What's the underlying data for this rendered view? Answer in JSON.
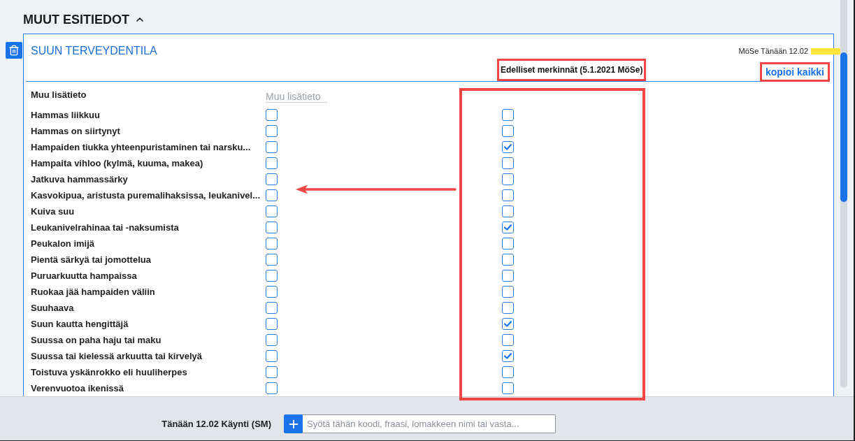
{
  "section": {
    "title": "MUUT ESITIEDOT",
    "expanded": true
  },
  "form": {
    "title": "SUUN TERVEYDENTILA",
    "stamp": "MöSe Tänään 12.02",
    "previous_heading": "Edelliset merkinnät (5.1.2021 MöSe)",
    "copy_all": "kopioi kaikki",
    "note": {
      "label": "Muu lisätieto",
      "placeholder": "Muu lisätieto"
    },
    "items": [
      {
        "label": "Hammas liikkuu",
        "checked": false,
        "previous_checked": false
      },
      {
        "label": "Hammas on siirtynyt",
        "checked": false,
        "previous_checked": false
      },
      {
        "label": "Hampaiden tiukka yhteenpuristaminen tai narsku...",
        "checked": false,
        "previous_checked": true
      },
      {
        "label": "Hampaita vihloo (kylmä, kuuma, makea)",
        "checked": false,
        "previous_checked": false
      },
      {
        "label": "Jatkuva hammassärky",
        "checked": false,
        "previous_checked": false
      },
      {
        "label": "Kasvokipua, aristusta puremalihaksissa, leukanivel...",
        "checked": false,
        "previous_checked": false
      },
      {
        "label": "Kuiva suu",
        "checked": false,
        "previous_checked": false
      },
      {
        "label": "Leukanivelrahinaa tai -naksumista",
        "checked": false,
        "previous_checked": true
      },
      {
        "label": "Peukalon imijä",
        "checked": false,
        "previous_checked": false
      },
      {
        "label": "Pientä särkyä tai jomottelua",
        "checked": false,
        "previous_checked": false
      },
      {
        "label": "Puruarkuutta hampaissa",
        "checked": false,
        "previous_checked": false
      },
      {
        "label": "Ruokaa jää hampaiden väliin",
        "checked": false,
        "previous_checked": false
      },
      {
        "label": "Suuhaava",
        "checked": false,
        "previous_checked": false
      },
      {
        "label": "Suun kautta hengittäjä",
        "checked": false,
        "previous_checked": true
      },
      {
        "label": "Suussa on paha haju tai maku",
        "checked": false,
        "previous_checked": false
      },
      {
        "label": "Suussa tai kielessä arkuutta tai kirvelyä",
        "checked": false,
        "previous_checked": true
      },
      {
        "label": "Toistuva yskänrokko eli huuliherpes",
        "checked": false,
        "previous_checked": false
      },
      {
        "label": "Verenvuotoa ikenissä",
        "checked": false,
        "previous_checked": false
      }
    ]
  },
  "footer": {
    "visit": "Tänään 12.02 Käynti (SM)",
    "search": {
      "placeholder": "Syötä tähän koodi, fraasi, lomakkeen nimi tai vasta..."
    }
  }
}
